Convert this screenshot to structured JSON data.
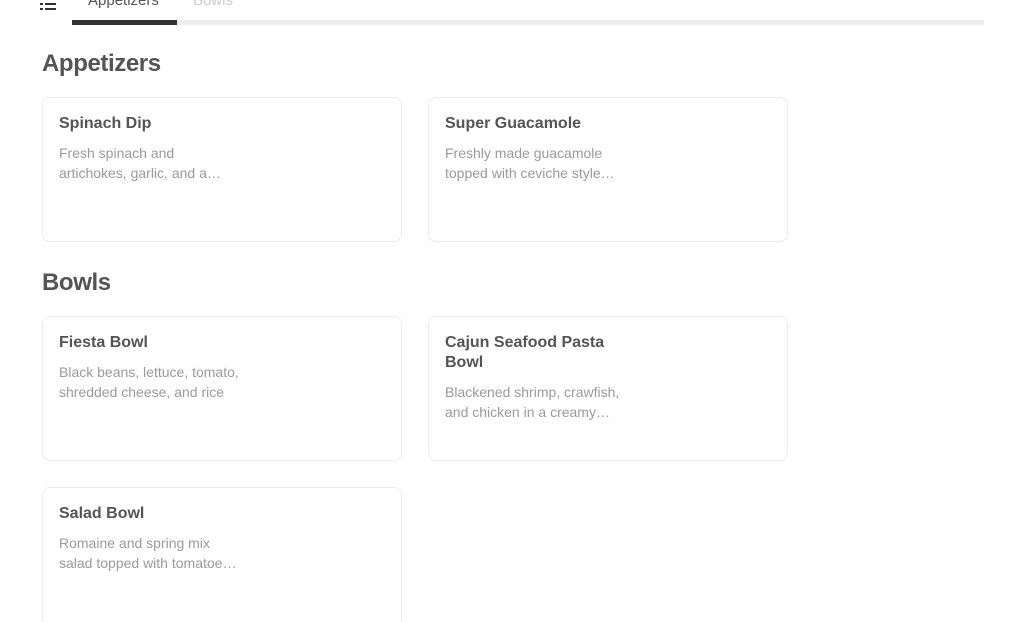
{
  "tabs": [
    {
      "label": "Appetizers",
      "active": true
    },
    {
      "label": "Bowls",
      "active": false
    }
  ],
  "sections": [
    {
      "title": "Appetizers",
      "items": [
        {
          "name": "Spinach Dip",
          "description": "Fresh spinach and artichokes, garlic, and a blend of cheeses"
        },
        {
          "name": "Super Guacamole",
          "description": "Freshly made guacamole topped with ceviche style shrimp"
        }
      ]
    },
    {
      "title": "Bowls",
      "items": [
        {
          "name": "Fiesta Bowl",
          "description": "Black beans, lettuce, tomato, shredded cheese, and rice"
        },
        {
          "name": "Cajun Seafood Pasta Bowl",
          "description": "Blackened shrimp, crawfish, and chicken in a creamy cajun sauce"
        },
        {
          "name": "Salad Bowl",
          "description": "Romaine and spring mix salad topped with tomatoes and cucumbers"
        }
      ]
    }
  ],
  "colors": {
    "text": "#545454",
    "muted": "#9a9a9a",
    "tab_inactive": "#cccccc",
    "indicator": "#333333",
    "card_border": "#ececec"
  }
}
